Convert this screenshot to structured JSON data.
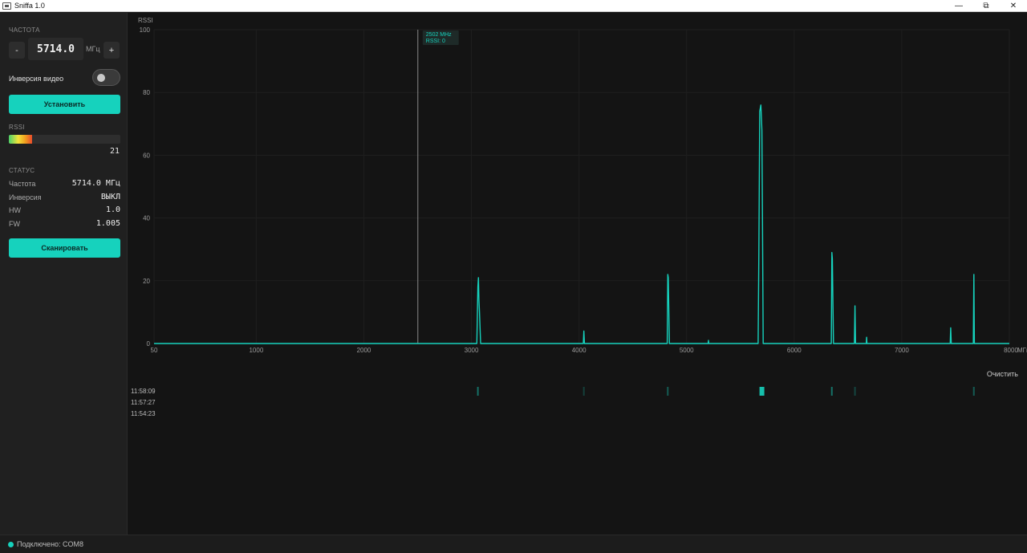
{
  "window": {
    "title": "Sniffa 1.0"
  },
  "sidebar": {
    "frequency_label": "ЧАСТОТА",
    "frequency_value": "5714.0",
    "frequency_unit": "МГц",
    "minus_label": "-",
    "plus_label": "+",
    "invert_label": "Инверсия видео",
    "invert_on": false,
    "set_button": "Установить",
    "rssi_label": "RSSI",
    "rssi_value": "21",
    "rssi_level_percent": 21,
    "status_label": "СТАТУС",
    "status": [
      {
        "key": "Частота",
        "value": "5714.0 МГц"
      },
      {
        "key": "Инверсия",
        "value": "ВЫКЛ"
      },
      {
        "key": "HW",
        "value": "1.0"
      },
      {
        "key": "FW",
        "value": "1.005"
      }
    ],
    "scan_button": "Сканировать"
  },
  "chart_data": {
    "type": "line",
    "ylabel": "RSSI",
    "xunit": "МГц",
    "xlim": [
      50,
      8000
    ],
    "ylim": [
      0,
      100
    ],
    "x_ticks": [
      50,
      1000,
      2000,
      3000,
      4000,
      5000,
      6000,
      7000,
      8000
    ],
    "x_tick_labels": [
      "50",
      "1000",
      "2000",
      "3000",
      "4000",
      "5000",
      "6000",
      "7000",
      "8000"
    ],
    "y_ticks": [
      0,
      20,
      40,
      60,
      80,
      100
    ],
    "grid": true,
    "color": "#16d2bd",
    "x": [
      50,
      3050,
      3060,
      3065,
      3070,
      3075,
      3085,
      4040,
      4045,
      4050,
      4820,
      4825,
      4830,
      4840,
      5200,
      5203,
      5206,
      5665,
      5672,
      5680,
      5690,
      5700,
      5705,
      5712,
      5718,
      6345,
      6350,
      6355,
      6365,
      6560,
      6565,
      6570,
      6670,
      6673,
      6676,
      7450,
      7455,
      7460,
      7665,
      7670,
      7675,
      8000
    ],
    "y": [
      0,
      0,
      18,
      21,
      14,
      10,
      0,
      0,
      4,
      0,
      0,
      22,
      21,
      0,
      0,
      1,
      0,
      0,
      29,
      74,
      76,
      68,
      40,
      0,
      0,
      0,
      29,
      27,
      0,
      0,
      12,
      0,
      0,
      2,
      0,
      0,
      5,
      0,
      0,
      22,
      0,
      0
    ],
    "cursor": {
      "x": 2502,
      "label_freq": "2502 MHz",
      "label_rssi": "RSSI: 0"
    }
  },
  "waterfall": {
    "clear_button": "Очистить",
    "rows": [
      "11:58:09",
      "11:57:27",
      "11:54:23"
    ],
    "marks": [
      {
        "row": 0,
        "freq": 3060,
        "strength": 0.45
      },
      {
        "row": 0,
        "freq": 4045,
        "strength": 0.1
      },
      {
        "row": 0,
        "freq": 4825,
        "strength": 0.3
      },
      {
        "row": 0,
        "freq": 5700,
        "strength": 1.0
      },
      {
        "row": 0,
        "freq": 6350,
        "strength": 0.45
      },
      {
        "row": 0,
        "freq": 6565,
        "strength": 0.15
      },
      {
        "row": 0,
        "freq": 7670,
        "strength": 0.3
      }
    ]
  },
  "statusbar": {
    "connection": "Подключено: COM8"
  }
}
